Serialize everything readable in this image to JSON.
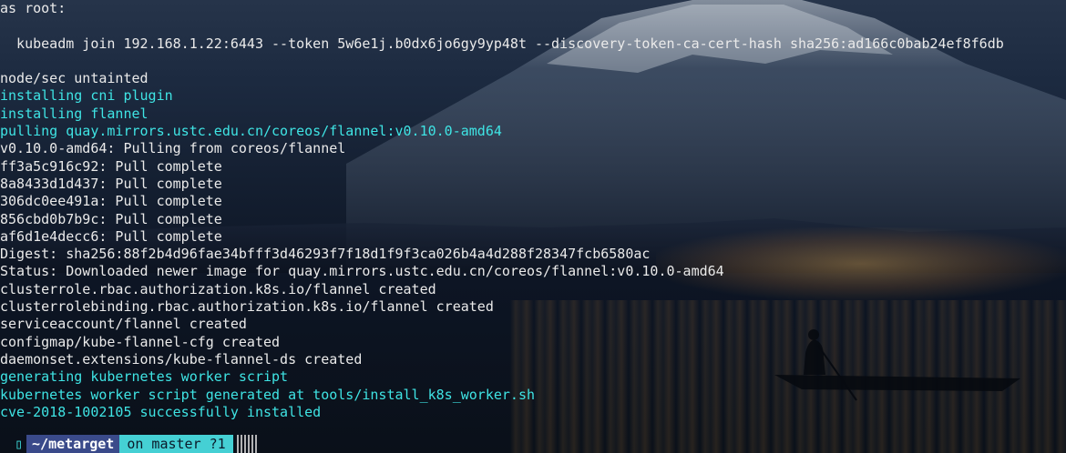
{
  "terminal": {
    "lines": [
      {
        "text": "as root:",
        "color": "white"
      },
      {
        "text": "",
        "color": "white"
      },
      {
        "text": "  kubeadm join 192.168.1.22:6443 --token 5w6e1j.b0dx6jo6gy9yp48t --discovery-token-ca-cert-hash sha256:ad166c0bab24ef8f6db",
        "color": "white"
      },
      {
        "text": "",
        "color": "white"
      },
      {
        "text": "node/sec untainted",
        "color": "white"
      },
      {
        "text": "installing cni plugin",
        "color": "cyan"
      },
      {
        "text": "installing flannel",
        "color": "cyan"
      },
      {
        "text": "pulling quay.mirrors.ustc.edu.cn/coreos/flannel:v0.10.0-amd64",
        "color": "cyan"
      },
      {
        "text": "v0.10.0-amd64: Pulling from coreos/flannel",
        "color": "white"
      },
      {
        "text": "ff3a5c916c92: Pull complete",
        "color": "white"
      },
      {
        "text": "8a8433d1d437: Pull complete",
        "color": "white"
      },
      {
        "text": "306dc0ee491a: Pull complete",
        "color": "white"
      },
      {
        "text": "856cbd0b7b9c: Pull complete",
        "color": "white"
      },
      {
        "text": "af6d1e4decc6: Pull complete",
        "color": "white"
      },
      {
        "text": "Digest: sha256:88f2b4d96fae34bfff3d46293f7f18d1f9f3ca026b4a4d288f28347fcb6580ac",
        "color": "white"
      },
      {
        "text": "Status: Downloaded newer image for quay.mirrors.ustc.edu.cn/coreos/flannel:v0.10.0-amd64",
        "color": "white"
      },
      {
        "text": "clusterrole.rbac.authorization.k8s.io/flannel created",
        "color": "white"
      },
      {
        "text": "clusterrolebinding.rbac.authorization.k8s.io/flannel created",
        "color": "white"
      },
      {
        "text": "serviceaccount/flannel created",
        "color": "white"
      },
      {
        "text": "configmap/kube-flannel-cfg created",
        "color": "white"
      },
      {
        "text": "daemonset.extensions/kube-flannel-ds created",
        "color": "white"
      },
      {
        "text": "generating kubernetes worker script",
        "color": "cyan"
      },
      {
        "text": "kubernetes worker script generated at tools/install_k8s_worker.sh",
        "color": "cyan"
      },
      {
        "text": "cve-2018-1002105 successfully installed",
        "color": "cyan"
      }
    ],
    "prompt": {
      "icon": "▯",
      "path": "~/metarget",
      "git_status": "on master ?1"
    },
    "colors": {
      "white": "#eaeaea",
      "cyan": "#3fe4e4",
      "path_bg": "#3a4a8a",
      "git_bg": "#45d0d4"
    }
  }
}
